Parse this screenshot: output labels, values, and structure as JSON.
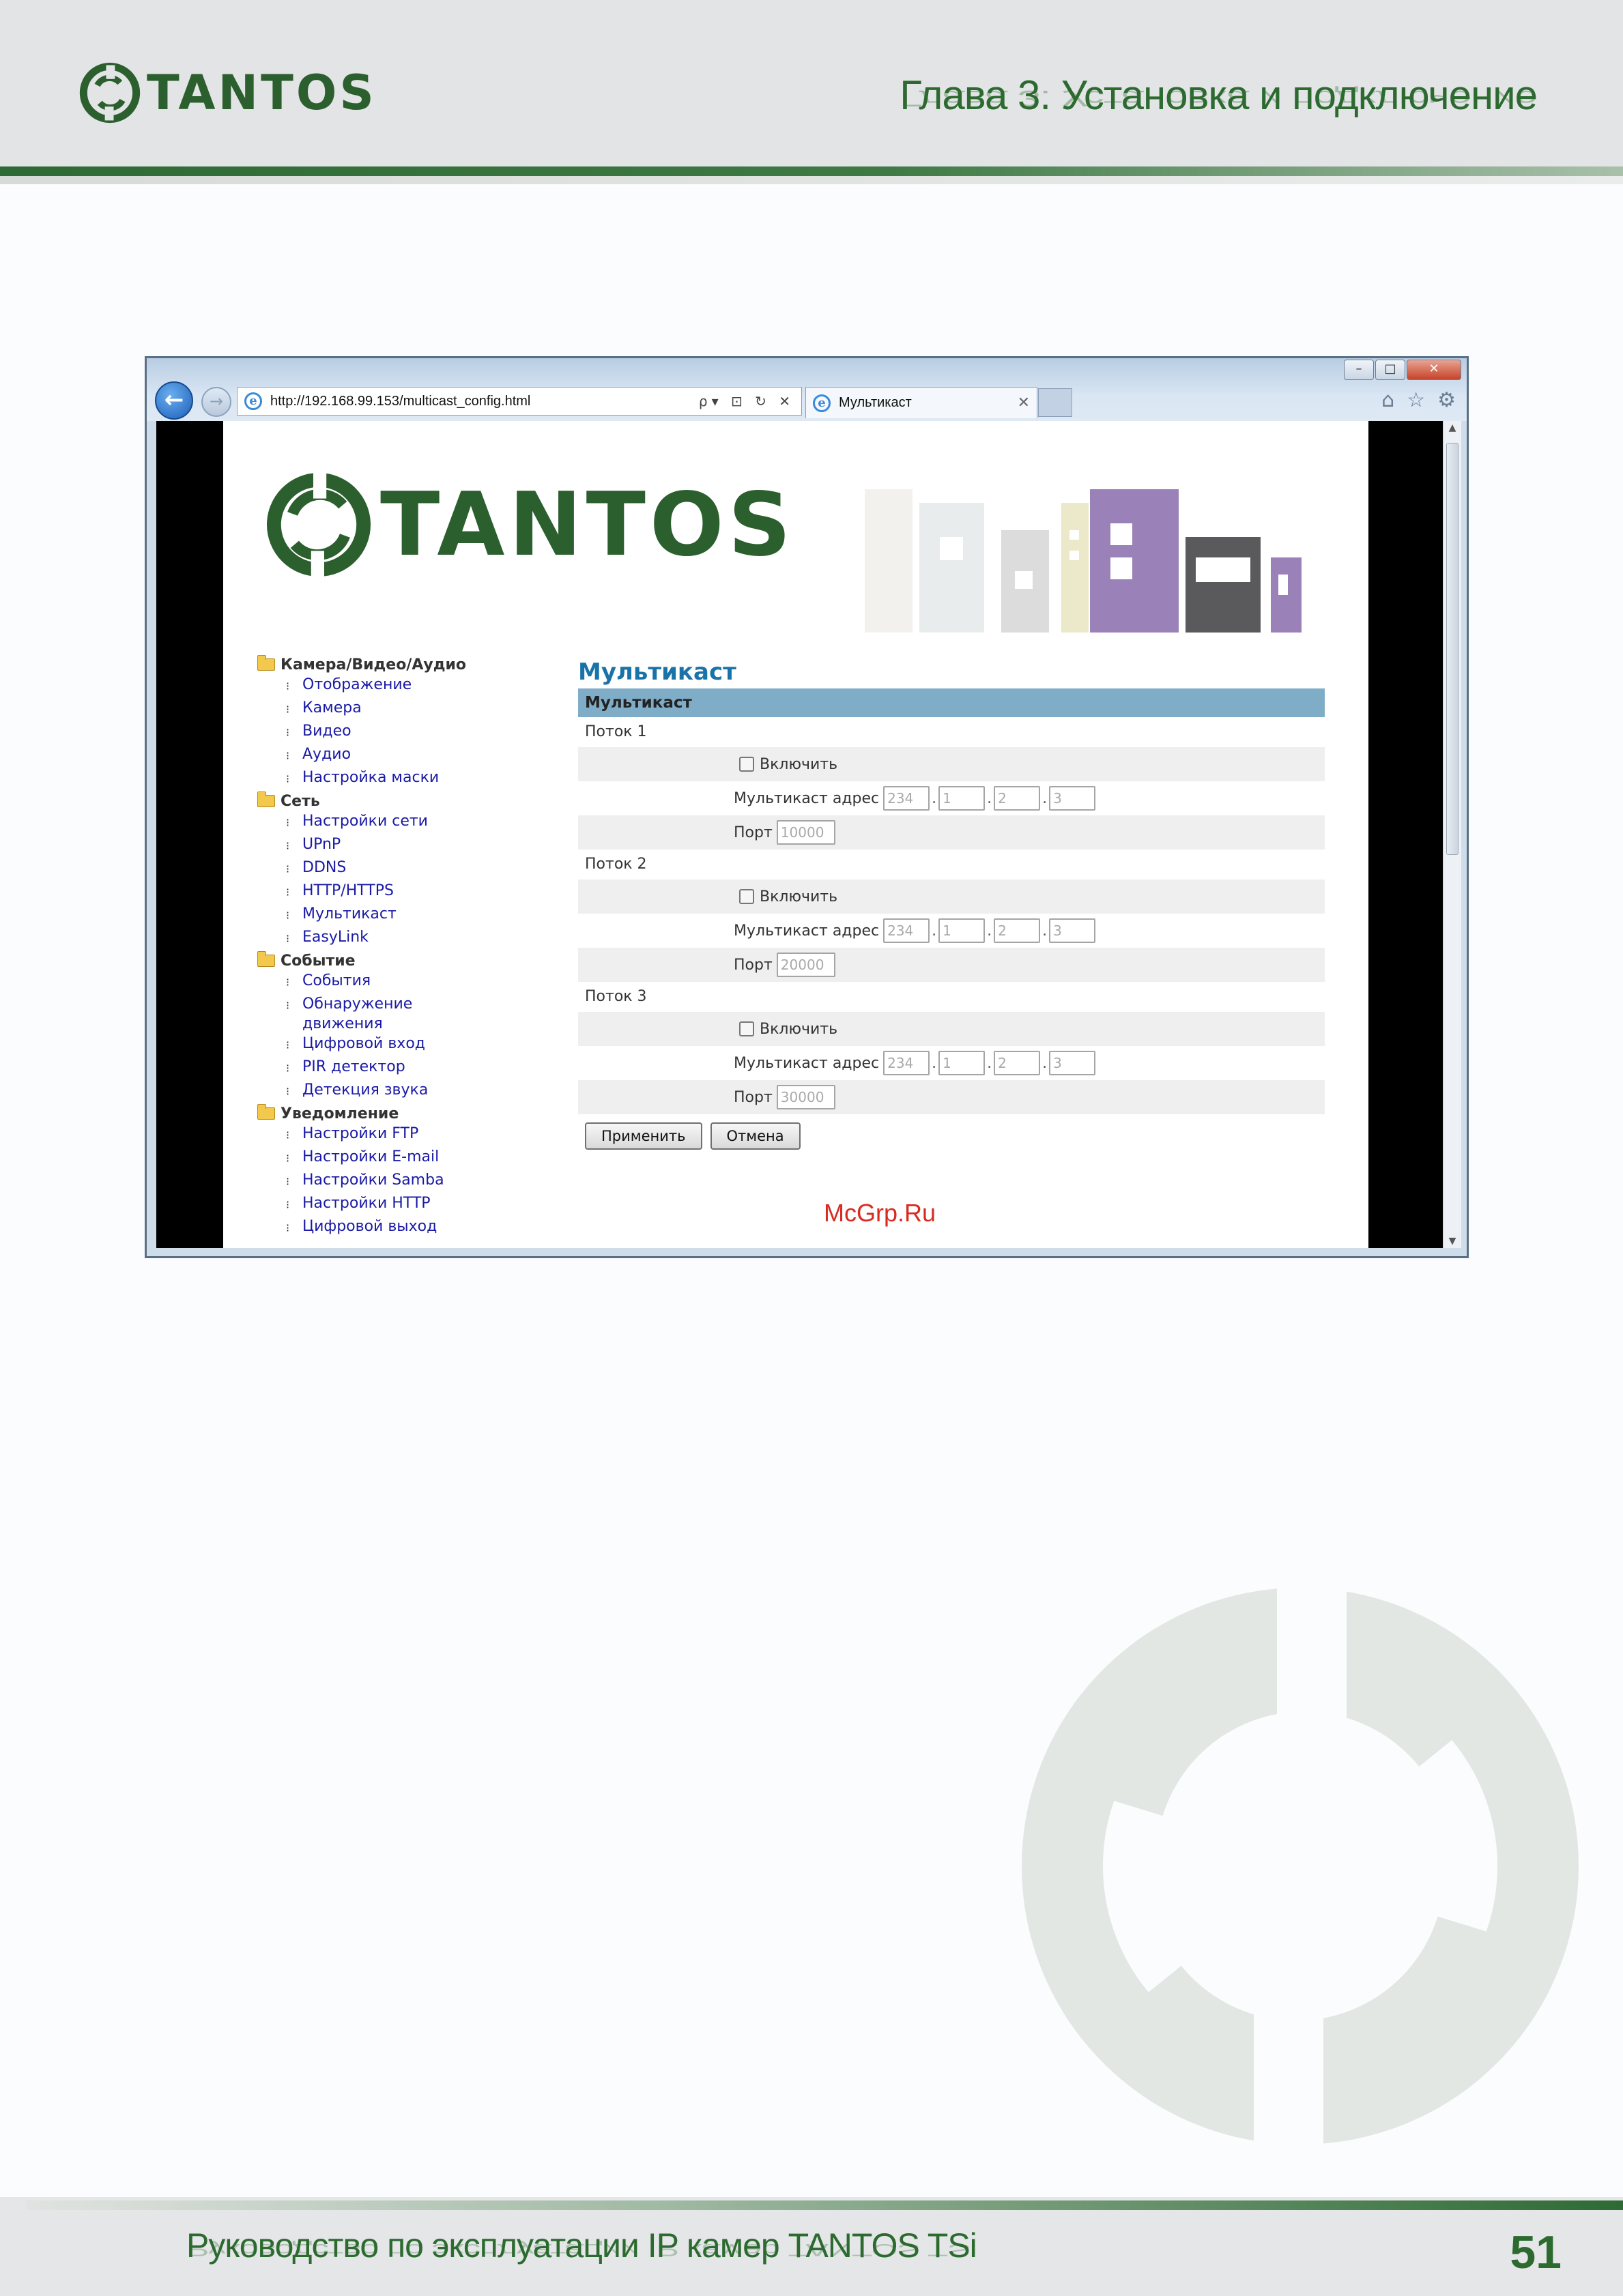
{
  "page_header": {
    "logo_text": "TANTOS",
    "chapter_title": "Глава 3. Установка и подключение"
  },
  "browser": {
    "url": "http://192.168.99.153/multicast_config.html",
    "tab_title": "Мультикаст",
    "url_tools": "ρ▾ ⊡ ↻ ✕",
    "window_buttons": {
      "minimize": "–",
      "maximize": "□",
      "close": "✕"
    }
  },
  "site": {
    "logo_text": "TANTOS",
    "nav": [
      {
        "section": "Камера/Видео/Аудио",
        "items": [
          "Отображение",
          "Камера",
          "Видео",
          "Аудио",
          "Настройка маски"
        ]
      },
      {
        "section": "Сеть",
        "items": [
          "Настройки сети",
          "UPnP",
          "DDNS",
          "HTTP/HTTPS",
          "Мультикаст",
          "EasyLink"
        ]
      },
      {
        "section": "Событие",
        "items": [
          "События",
          "Обнаружение движения",
          "Цифровой вход",
          "PIR детектор",
          "Детекция звука"
        ]
      },
      {
        "section": "Уведомление",
        "items": [
          "Настройки FTP",
          "Настройки E-mail",
          "Настройки Samba",
          "Настройки HTTP",
          "Цифровой выход"
        ]
      }
    ],
    "content": {
      "heading": "Мультикаст",
      "section_title": "Мультикаст",
      "enable_label": "Включить",
      "address_label": "Мультикаст адрес",
      "port_label": "Порт",
      "streams": [
        {
          "label": "Поток 1",
          "ip": [
            "234",
            "1",
            "2",
            "3"
          ],
          "port": "10000"
        },
        {
          "label": "Поток 2",
          "ip": [
            "234",
            "1",
            "2",
            "3"
          ],
          "port": "20000"
        },
        {
          "label": "Поток 3",
          "ip": [
            "234",
            "1",
            "2",
            "3"
          ],
          "port": "30000"
        }
      ],
      "apply_button": "Применить",
      "cancel_button": "Отмена"
    },
    "overlay_watermark": "McGrp.Ru"
  },
  "page_footer": {
    "title": "Руководство по эксплуатации IP камер TANTOS TSi",
    "page_number": "51"
  },
  "colors": {
    "brand_green": "#2c6a30",
    "accent_blue": "#1a73a8",
    "section_bar": "#7fadc8"
  }
}
